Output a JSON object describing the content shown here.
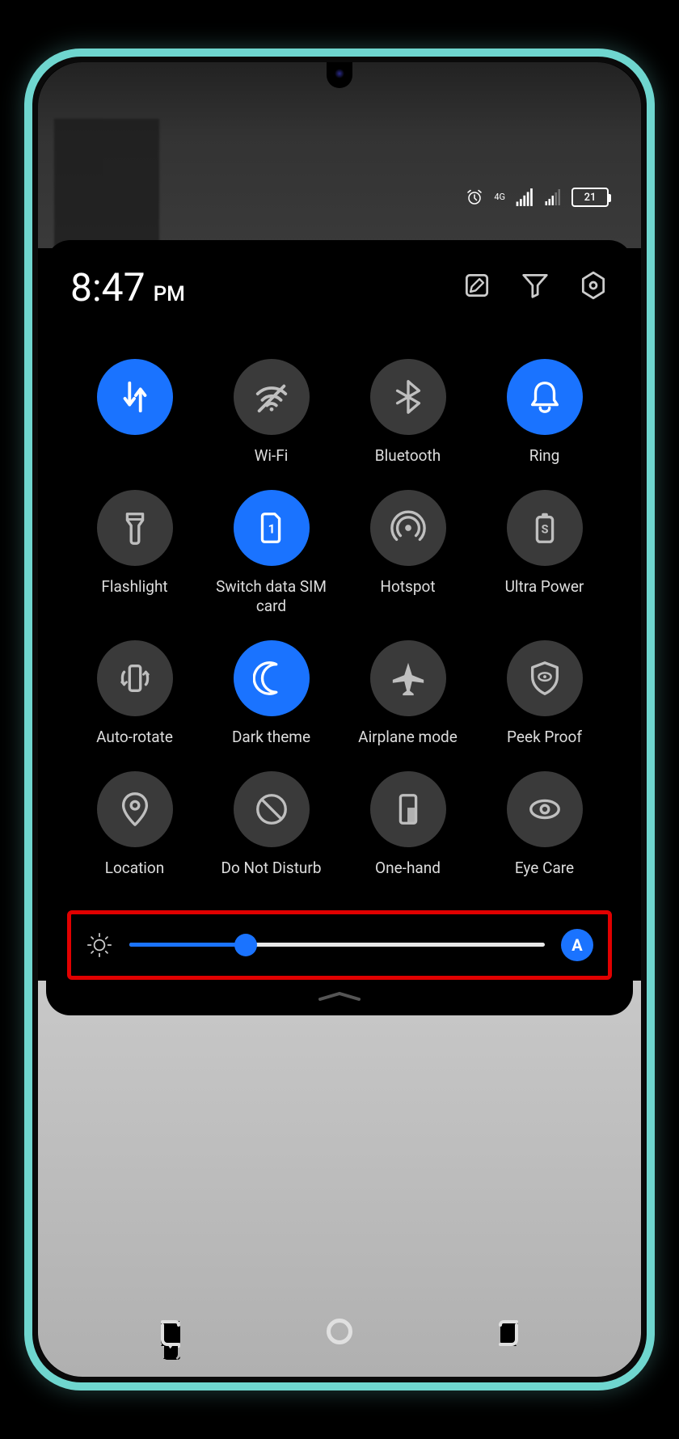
{
  "status": {
    "battery": "21",
    "network_badge": "4G"
  },
  "header": {
    "time": "8:47",
    "suffix": "PM"
  },
  "tiles": [
    {
      "id": "mobile-data",
      "label": "",
      "active": true,
      "icon": "data-arrows"
    },
    {
      "id": "wifi",
      "label": "Wi-Fi",
      "active": false,
      "icon": "wifi-off"
    },
    {
      "id": "bluetooth",
      "label": "Bluetooth",
      "active": false,
      "icon": "bluetooth"
    },
    {
      "id": "ring",
      "label": "Ring",
      "active": true,
      "icon": "bell"
    },
    {
      "id": "flashlight",
      "label": "Flashlight",
      "active": false,
      "icon": "flashlight"
    },
    {
      "id": "switch-sim",
      "label": "Switch data SIM card",
      "active": true,
      "icon": "sim"
    },
    {
      "id": "hotspot",
      "label": "Hotspot",
      "active": false,
      "icon": "hotspot"
    },
    {
      "id": "ultra-power",
      "label": "Ultra Power",
      "active": false,
      "icon": "battery-s"
    },
    {
      "id": "auto-rotate",
      "label": "Auto-rotate",
      "active": false,
      "icon": "rotate"
    },
    {
      "id": "dark-theme",
      "label": "Dark theme",
      "active": true,
      "icon": "moon"
    },
    {
      "id": "airplane",
      "label": "Airplane mode",
      "active": false,
      "icon": "airplane"
    },
    {
      "id": "peek-proof",
      "label": "Peek Proof",
      "active": false,
      "icon": "shield-eye"
    },
    {
      "id": "location",
      "label": "Location",
      "active": false,
      "icon": "pin"
    },
    {
      "id": "dnd",
      "label": "Do Not Disturb",
      "active": false,
      "icon": "dnd"
    },
    {
      "id": "one-hand",
      "label": "One-hand",
      "active": false,
      "icon": "one-hand"
    },
    {
      "id": "eye-care",
      "label": "Eye Care",
      "active": false,
      "icon": "eye"
    }
  ],
  "brightness": {
    "percent": 28,
    "auto_label": "A"
  }
}
